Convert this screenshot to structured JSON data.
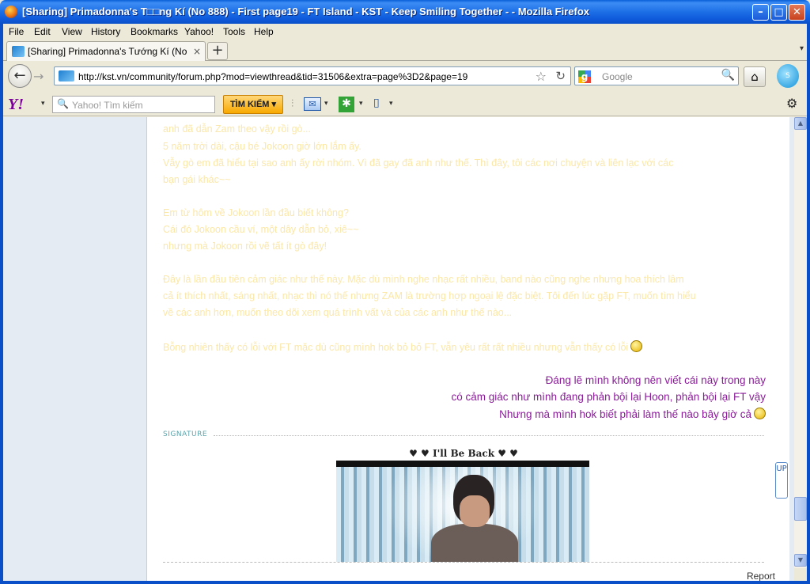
{
  "window": {
    "title": "[Sharing] Primadonna's T□□ng Kí (No 888) - First page19 - FT Island - KST - Keep Smiling Together - - Mozilla Firefox",
    "minimize": "–",
    "maximize": "□",
    "close": "✕"
  },
  "menu": [
    "File",
    "Edit",
    "View",
    "History",
    "Bookmarks",
    "Yahoo!",
    "Tools",
    "Help"
  ],
  "tab": {
    "label": "[Sharing] Primadonna's Tướng Kí (No 888) - ...",
    "close": "×",
    "new": "+",
    "list": "▾"
  },
  "nav": {
    "back": "←",
    "forward": "→",
    "url": "http://kst.vn/community/forum.php?mod=viewthread&tid=31506&extra=page%3D2&page=19",
    "star": "☆",
    "reload": "↻",
    "search_engine_letter": "g",
    "search_placeholder": "Google",
    "search_icon": "🔍",
    "home": "⌂",
    "skype": "S"
  },
  "yahoo": {
    "logo": "Y!",
    "search_placeholder": "Yahoo! Tìm kiếm",
    "search_button": "TÌM KIẾM ▾",
    "mail": "✉",
    "star": "✱",
    "book": "▯",
    "gear": "⚙",
    "arrow": "▾",
    "sep": "⫶"
  },
  "post": {
    "faint_lines": [
      "anh đã dẫn Zam theo vậy rồi gò...",
      "5 năm trời dài, cậu bé Jokoon giờ lớn lắm ấy.",
      "Vẫy gò em đã hiểu tại sao anh ấy rời nhóm. Vì đã gay đã anh như thế. Thì đây, tôi các nơi chuyện và liên lạc với các",
      "bạn gái khác~~",
      "Em từ hôm về Jokoon lần đầu biết không?",
      "Cái đó Jokoon cầu ví, một dây dẫn bỏ, xiê~~",
      "nhưng mà Jokoon rồi vẽ tất ít gò đây!",
      "Đây là lần đầu tiên cảm giác như thế này. Mặc dù mình nghe nhạc rất nhiều, band nào cũng nghe nhưng hoa thích lâm",
      "cả ít thích nhất, sáng nhất, nhạc thì nó thế nhưng ZAM là trường hợp ngoại lệ đặc biệt. Tôi đến lúc gặp FT, muốn tìm hiểu",
      "về các anh hơn, muốn theo dõi xem quá trình vất và của các anh như thế nào...",
      "Bỗng nhiên thấy có lỗi với FT mặc dù cũng mình hok bỏ bỏ FT, vẫn yêu rất rất nhiều nhưng vẫn thấy có lỗi"
    ],
    "purple_lines": [
      "Đáng lẽ mình không nên viết cái này trong này",
      "có cảm giác như mình đang phản bội lại Hoon, phản bội lại FT vậy",
      "Nhưng mà mình hok biết phải làm thế nào bây giờ cả"
    ],
    "signature_label": "SIGNATURE",
    "signature_title": "♥ ♥ I'll Be Back ♥ ♥",
    "report": "Report",
    "up_button": "UP"
  },
  "scrollbar": {
    "up": "▲",
    "down": "▼"
  }
}
